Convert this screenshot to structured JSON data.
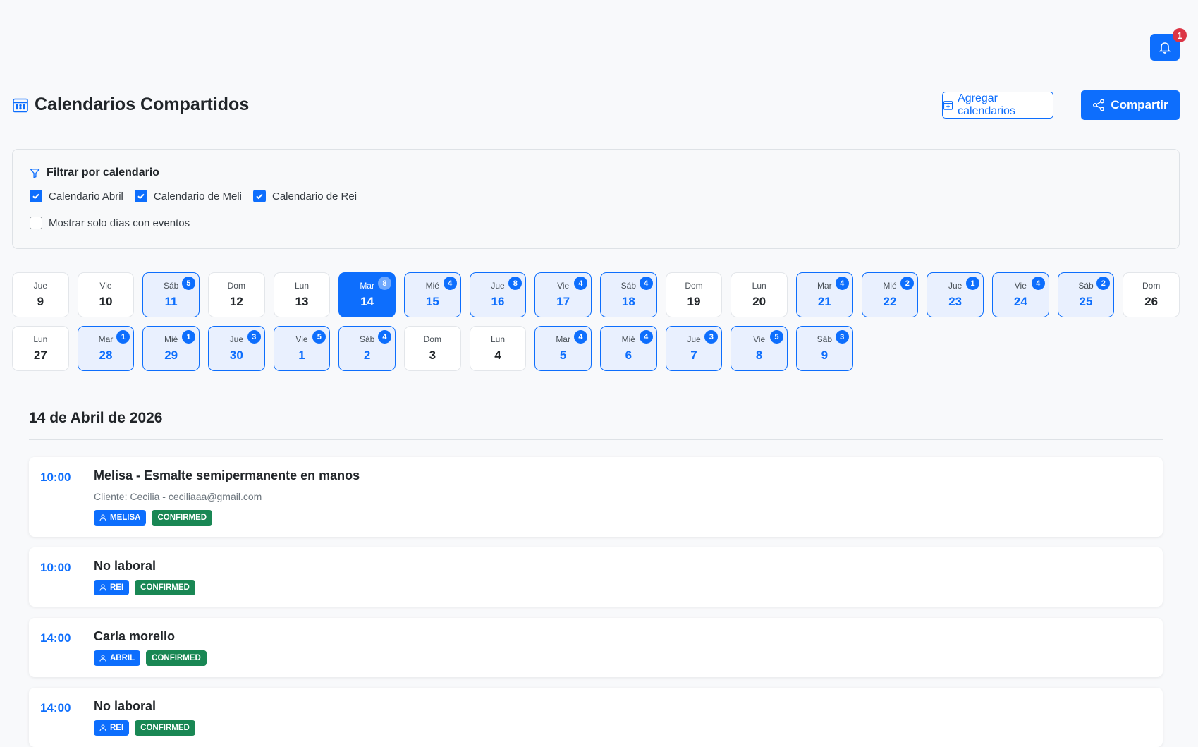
{
  "notifications": {
    "count": "1",
    "icon": "bell-icon"
  },
  "header": {
    "title": "Calendarios Compartidos",
    "add_label": "Agregar calendarios",
    "share_label": "Compartir"
  },
  "filter": {
    "title": "Filtrar por calendario",
    "calendars": [
      {
        "label": "Calendario Abril",
        "checked": true
      },
      {
        "label": "Calendario de Meli",
        "checked": true
      },
      {
        "label": "Calendario de Rei",
        "checked": true
      }
    ],
    "only_with_events": {
      "label": "Mostrar solo días con eventos",
      "checked": false
    }
  },
  "days": [
    {
      "name": "Jue",
      "num": "9",
      "count": ""
    },
    {
      "name": "Vie",
      "num": "10",
      "count": ""
    },
    {
      "name": "Sáb",
      "num": "11",
      "count": "5"
    },
    {
      "name": "Dom",
      "num": "12",
      "count": ""
    },
    {
      "name": "Lun",
      "num": "13",
      "count": ""
    },
    {
      "name": "Mar",
      "num": "14",
      "count": "8",
      "selected": true
    },
    {
      "name": "Mié",
      "num": "15",
      "count": "4"
    },
    {
      "name": "Jue",
      "num": "16",
      "count": "8"
    },
    {
      "name": "Vie",
      "num": "17",
      "count": "4"
    },
    {
      "name": "Sáb",
      "num": "18",
      "count": "4"
    },
    {
      "name": "Dom",
      "num": "19",
      "count": ""
    },
    {
      "name": "Lun",
      "num": "20",
      "count": ""
    },
    {
      "name": "Mar",
      "num": "21",
      "count": "4"
    },
    {
      "name": "Mié",
      "num": "22",
      "count": "2"
    },
    {
      "name": "Jue",
      "num": "23",
      "count": "1"
    },
    {
      "name": "Vie",
      "num": "24",
      "count": "4"
    },
    {
      "name": "Sáb",
      "num": "25",
      "count": "2"
    },
    {
      "name": "Dom",
      "num": "26",
      "count": ""
    },
    {
      "name": "Lun",
      "num": "27",
      "count": ""
    },
    {
      "name": "Mar",
      "num": "28",
      "count": "1"
    },
    {
      "name": "Mié",
      "num": "29",
      "count": "1"
    },
    {
      "name": "Jue",
      "num": "30",
      "count": "3"
    },
    {
      "name": "Vie",
      "num": "1",
      "count": "5"
    },
    {
      "name": "Sáb",
      "num": "2",
      "count": "4"
    },
    {
      "name": "Dom",
      "num": "3",
      "count": ""
    },
    {
      "name": "Lun",
      "num": "4",
      "count": ""
    },
    {
      "name": "Mar",
      "num": "5",
      "count": "4"
    },
    {
      "name": "Mié",
      "num": "6",
      "count": "4"
    },
    {
      "name": "Jue",
      "num": "7",
      "count": "3"
    },
    {
      "name": "Vie",
      "num": "8",
      "count": "5"
    },
    {
      "name": "Sáb",
      "num": "9",
      "count": "3"
    }
  ],
  "selected_date": "14 de Abril de 2026",
  "events": [
    {
      "time": "10:00",
      "title": "Melisa - Esmalte semipermanente en manos",
      "subtitle": "Cliente: Cecilia - ceciliaaa@gmail.com",
      "person": "MELISA",
      "status": "CONFIRMED"
    },
    {
      "time": "10:00",
      "title": "No laboral",
      "subtitle": "",
      "person": "REI",
      "status": "CONFIRMED"
    },
    {
      "time": "14:00",
      "title": "Carla morello",
      "subtitle": "",
      "person": "ABRIL",
      "status": "CONFIRMED"
    },
    {
      "time": "14:00",
      "title": "No laboral",
      "subtitle": "",
      "person": "REI",
      "status": "CONFIRMED"
    }
  ],
  "colors": {
    "primary": "#0d6efd",
    "success": "#198754",
    "danger": "#dc3545"
  }
}
